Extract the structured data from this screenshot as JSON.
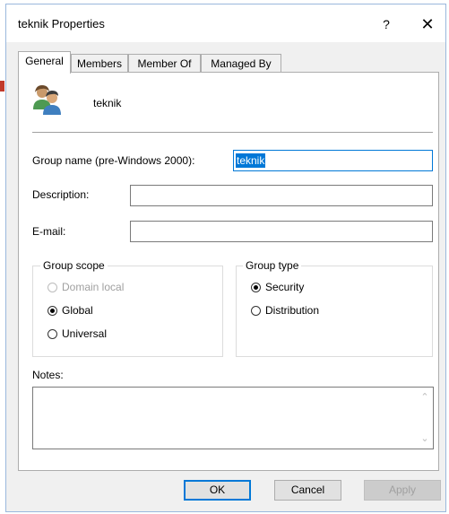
{
  "window": {
    "title": "teknik Properties",
    "help_label": "?",
    "close_label": "✕"
  },
  "tabs": [
    {
      "label": "General",
      "active": true
    },
    {
      "label": "Members",
      "active": false
    },
    {
      "label": "Member Of",
      "active": false
    },
    {
      "label": "Managed By",
      "active": false
    }
  ],
  "header": {
    "group_name": "teknik",
    "icon": "group-icon"
  },
  "fields": {
    "group_name_label": "Group name (pre-Windows 2000):",
    "group_name_value": "teknik",
    "description_label": "Description:",
    "description_value": "",
    "email_label": "E-mail:",
    "email_value": ""
  },
  "group_scope": {
    "title": "Group scope",
    "options": [
      {
        "label": "Domain local",
        "checked": false,
        "disabled": true
      },
      {
        "label": "Global",
        "checked": true,
        "disabled": false
      },
      {
        "label": "Universal",
        "checked": false,
        "disabled": false
      }
    ]
  },
  "group_type": {
    "title": "Group type",
    "options": [
      {
        "label": "Security",
        "checked": true
      },
      {
        "label": "Distribution",
        "checked": false
      }
    ]
  },
  "notes": {
    "label": "Notes:",
    "value": "",
    "scroll_up": "⌃",
    "scroll_down": "⌄"
  },
  "buttons": {
    "ok": "OK",
    "cancel": "Cancel",
    "apply": "Apply"
  }
}
